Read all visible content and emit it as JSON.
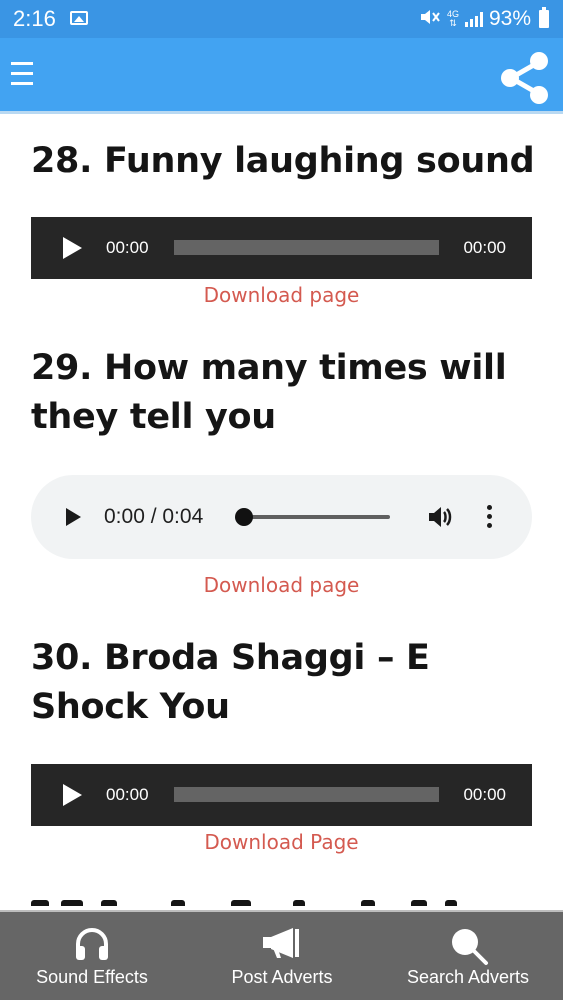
{
  "status_bar": {
    "time": "2:16",
    "network": "4G",
    "battery": "93%"
  },
  "app_bar": {
    "menu_icon": "hamburger-menu-icon",
    "share_icon": "share-icon"
  },
  "sounds": [
    {
      "title": "28. Funny laughing sound",
      "player": {
        "style": "dark",
        "current": "00:00",
        "duration": "00:00"
      },
      "link": "Download page"
    },
    {
      "title": "29. How many times will they tell you",
      "player": {
        "style": "light",
        "time": "0:00 / 0:04"
      },
      "link": "Download page"
    },
    {
      "title": "30. Broda Shaggi – E Shock You",
      "player": {
        "style": "dark",
        "current": "00:00",
        "duration": "00:00"
      },
      "link": "Download Page"
    }
  ],
  "bottom_nav": [
    {
      "label": "Sound Effects",
      "icon": "headphones-icon"
    },
    {
      "label": "Post Adverts",
      "icon": "megaphone-icon"
    },
    {
      "label": "Search Adverts",
      "icon": "search-icon"
    }
  ],
  "colors": {
    "status_bar": "#3a95e4",
    "app_bar": "#42a3f2",
    "link": "#d45a50",
    "player_dark": "#262626",
    "bottom_nav": "#666666"
  }
}
